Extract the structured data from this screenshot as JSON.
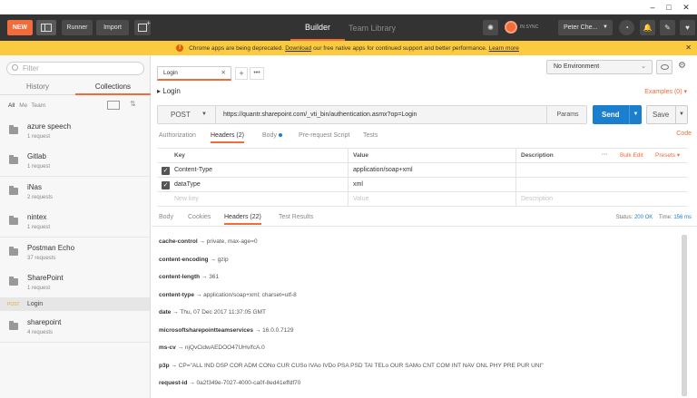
{
  "header": {
    "new_label": "NEW",
    "runner_label": "Runner",
    "import_label": "Import",
    "builder_label": "Builder",
    "team_library_label": "Team Library",
    "sync_label": "IN SYNC",
    "user_label": "Peter Che..."
  },
  "warning": {
    "text_before": "Chrome apps are being deprecated.",
    "link1": "Download",
    "text_middle": "our free native apps for continued support and better performance.",
    "link2": "Learn more"
  },
  "sidebar": {
    "filter_placeholder": "Filter",
    "tab_history": "History",
    "tab_collections": "Collections",
    "filter_all": "All",
    "filter_me": "Me",
    "filter_team": "Team",
    "collections": [
      {
        "name": "azure speech",
        "count": "1 request"
      },
      {
        "name": "Gitlab",
        "count": "1 request"
      },
      {
        "name": "iNas",
        "count": "2 requests"
      },
      {
        "name": "nintex",
        "count": "1 request"
      },
      {
        "name": "Postman Echo",
        "count": "37 requests"
      },
      {
        "name": "SharePoint",
        "count": "1 request"
      }
    ],
    "request": {
      "method": "POST",
      "name": "Login"
    },
    "collections_after": [
      {
        "name": "sharepoint",
        "count": "4 requests"
      }
    ]
  },
  "main": {
    "tab_label": "Login",
    "environment": "No Environment",
    "request_title": "Login",
    "examples": "Examples (0)",
    "method": "POST",
    "url": "https://quantr.sharepoint.com/_vti_bin/authentication.asmx?op=Login",
    "params": "Params",
    "send": "Send",
    "save": "Save",
    "req_tabs": {
      "authorization": "Authorization",
      "headers": "Headers (2)",
      "body": "Body",
      "prerequest": "Pre-request Script",
      "tests": "Tests",
      "code": "Code"
    },
    "headers_table": {
      "col_key": "Key",
      "col_value": "Value",
      "col_description": "Description",
      "more": "···",
      "bulk_edit": "Bulk Edit",
      "presets": "Presets",
      "rows": [
        {
          "key": "Content-Type",
          "value": "application/soap+xml"
        },
        {
          "key": "dataType",
          "value": "xml"
        }
      ],
      "new_key_placeholder": "New key",
      "value_placeholder": "Value",
      "description_placeholder": "Description"
    },
    "resp_tabs": {
      "body": "Body",
      "cookies": "Cookies",
      "headers": "Headers (22)",
      "test_results": "Test Results"
    },
    "status": {
      "label": "Status:",
      "value": "200 OK",
      "time_label": "Time:",
      "time_value": "156 ms"
    },
    "response_headers": [
      {
        "key": "cache-control →",
        "value": "private, max-age=0"
      },
      {
        "key": "content-encoding →",
        "value": "gzip"
      },
      {
        "key": "content-length →",
        "value": "361"
      },
      {
        "key": "content-type →",
        "value": "application/soap+xml; charset=utf-8"
      },
      {
        "key": "date →",
        "value": "Thu, 07 Dec 2017 11:37:05 GMT"
      },
      {
        "key": "microsoftsharepointteamservices →",
        "value": "16.0.0.7129"
      },
      {
        "key": "ms-cv →",
        "value": "njQvCidwAEDOO47UHv/fcA.0"
      },
      {
        "key": "p3p →",
        "value": "CP=\"ALL IND DSP COR ADM CONo CUR CUSo IVAo IVDo PSA PSD TAI TELo OUR SAMo CNT COM INT NAV ONL PHY PRE PUR UNI\""
      },
      {
        "key": "request-id →",
        "value": "0a2f349e-7027-4000-ca0f-8ed41effdf70"
      }
    ]
  },
  "colors": {
    "accent": "#f26b3a",
    "send": "#1b7fce",
    "header_bg": "#333333",
    "warning_bg": "#fbca3e"
  }
}
